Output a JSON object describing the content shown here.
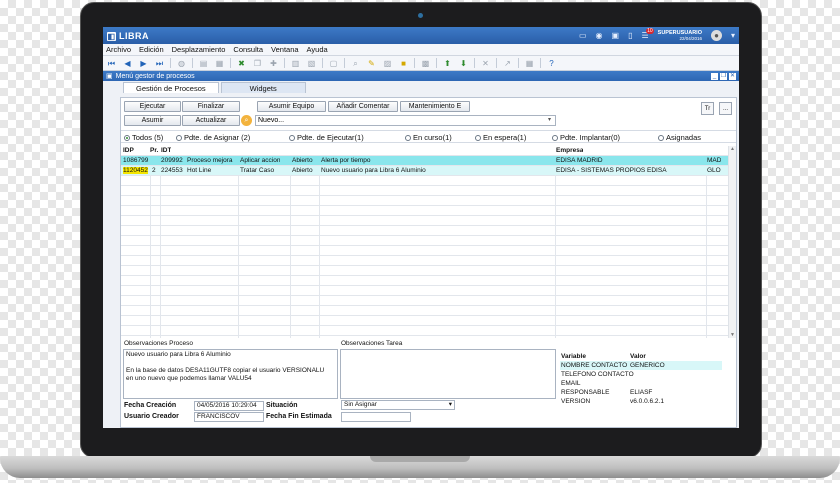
{
  "app": {
    "logo_text": "LIBRA",
    "user_name": "SUPERUSUARIO",
    "user_date": "22/04/2016",
    "notifications": "10"
  },
  "menu": [
    "Archivo",
    "Edición",
    "Desplazamiento",
    "Consulta",
    "Ventana",
    "Ayuda"
  ],
  "subwindow": {
    "title": "Menú gestor de procesos"
  },
  "tabs": [
    "Gestión de Procesos",
    "Widgets"
  ],
  "buttons": {
    "ejecutar": "Ejecutar",
    "finalizar": "Finalizar",
    "asumir_equipo": "Asumir Equipo",
    "anadir_comentar": "Añadir Comentar",
    "mantenimiento": "Mantenimiento E",
    "asumir": "Asumir",
    "actualizar": "Actualizar",
    "side1": "Tr",
    "side2": "..."
  },
  "search": {
    "value": "Nuevo..."
  },
  "filters": {
    "todos": "Todos (5)",
    "asignar": "Pdte. de Asignar (2)",
    "ejecutar": "Pdte. de Ejecutar(1)",
    "en_curso": "En curso(1)",
    "en_espera": "En espera(1)",
    "implantar": "Pdte. Implantar(0)",
    "asignadas": "Asignadas"
  },
  "table": {
    "headers": {
      "idp": "IDP",
      "pr": "Pr.",
      "idt": "IDT",
      "empresa": "Empresa"
    },
    "rows": [
      {
        "idp": "1086799",
        "pr": "",
        "idt": "209992",
        "proceso": "Proceso mejora",
        "tarea": "Aplicar accion",
        "estado": "Abierto",
        "desc": "Alerta por tiempo",
        "empresa": "EDISA MADRID",
        "extra": "MAD"
      },
      {
        "idp_a": "11",
        "idp_b": "20452",
        "pr": "2",
        "idt": "224553",
        "proceso": "Hot Line",
        "tarea": "Tratar Caso",
        "estado": "Abierto",
        "desc": "Nuevo usuario para Libra 6 Aluminio",
        "empresa": "EDISA - SISTEMAS PROPIOS EDISA",
        "extra": "GLO"
      }
    ]
  },
  "observaciones": {
    "proceso_label": "Observaciones Proceso",
    "proceso_line1": "Nuevo usuario para Libra 6 Aluminio",
    "proceso_line2": "En la base de datos DESA11GUTF8 copiar el usuario VERSIONALU",
    "proceso_line3": "en uno nuevo que podemos llamar VALU54",
    "tarea_label": "Observaciones Tarea"
  },
  "variables": {
    "col_var": "Variable",
    "col_val": "Valor",
    "rows": [
      {
        "var": "NOMBRE CONTACTO",
        "val": "GENERICO"
      },
      {
        "var": "TELEFONO CONTACTO",
        "val": ""
      },
      {
        "var": "EMAIL",
        "val": ""
      },
      {
        "var": "RESPONSABLE",
        "val": "ELIASF"
      },
      {
        "var": "VERSION",
        "val": "v6.0.0.6.2.1"
      }
    ]
  },
  "details": {
    "fecha_creacion_label": "Fecha Creación",
    "fecha_creacion": "04/05/2016 10:29:04",
    "situacion_label": "Situación",
    "situacion": "Sin Asignar",
    "usuario_creador_label": "Usuario Creador",
    "usuario_creador": "FRANCISCOV",
    "fecha_fin_label": "Fecha Fin Estimada",
    "fecha_fin": ""
  }
}
